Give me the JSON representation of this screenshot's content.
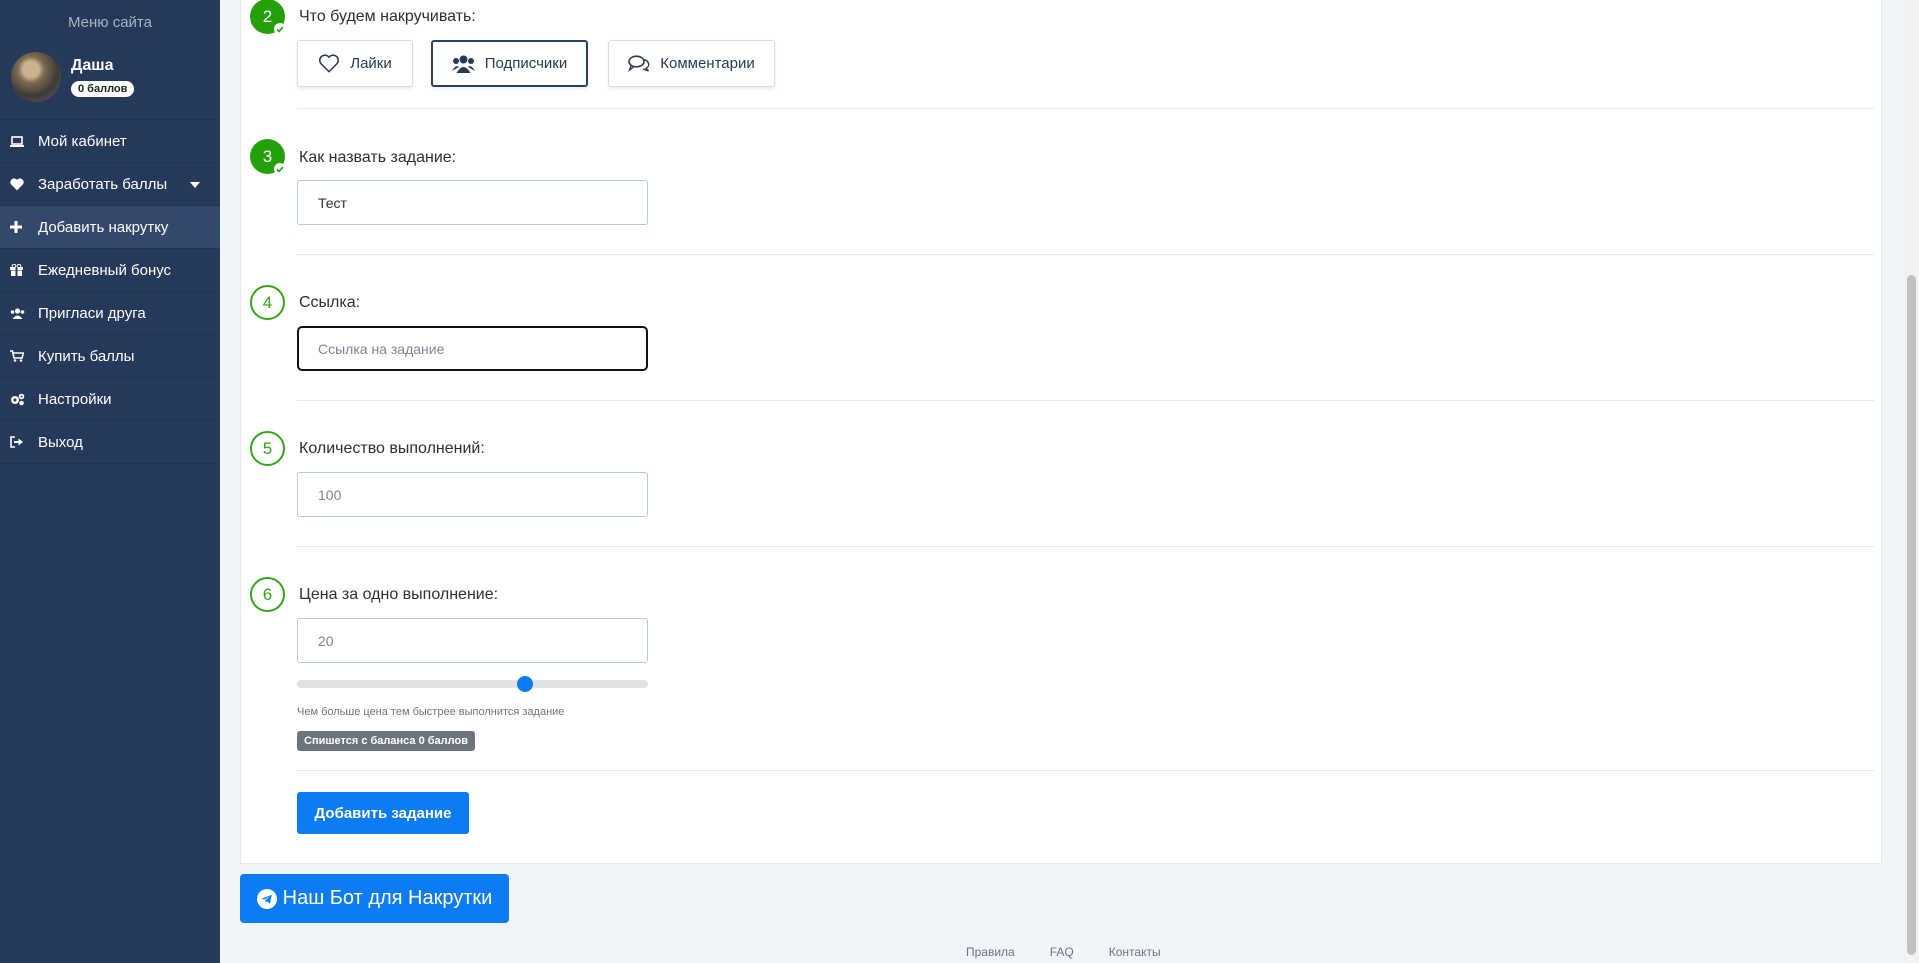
{
  "sidebar": {
    "title": "Меню сайта",
    "user": {
      "name": "Даша",
      "points": "0 баллов"
    },
    "items": [
      {
        "label": "Мой кабинет",
        "icon": "laptop-icon"
      },
      {
        "label": "Заработать баллы",
        "icon": "heart-icon"
      },
      {
        "label": "Добавить накрутку",
        "icon": "plus-icon"
      },
      {
        "label": "Ежедневный бонус",
        "icon": "gift-icon"
      },
      {
        "label": "Пригласи друга",
        "icon": "users-icon"
      },
      {
        "label": "Купить баллы",
        "icon": "cart-icon"
      },
      {
        "label": "Настройки",
        "icon": "gears-icon"
      },
      {
        "label": "Выход",
        "icon": "sign-out-icon"
      }
    ]
  },
  "form": {
    "step2": {
      "number": "2",
      "label": "Что будем накручивать:"
    },
    "types": [
      {
        "label": "Лайки",
        "icon": "heart-outline-icon"
      },
      {
        "label": "Подписчики",
        "icon": "users-icon"
      },
      {
        "label": "Комментарии",
        "icon": "comments-icon"
      }
    ],
    "step3": {
      "number": "3",
      "label": "Как назвать задание:",
      "value": "Тест"
    },
    "step4": {
      "number": "4",
      "label": "Ссылка:",
      "value": "",
      "placeholder": "Ссылка на задание"
    },
    "step5": {
      "number": "5",
      "label": "Количество выполнений:",
      "value": "",
      "placeholder": "100"
    },
    "step6": {
      "number": "6",
      "label": "Цена за одно выполнение:",
      "value": "",
      "placeholder": "20"
    },
    "price_slider_fraction": 0.65,
    "hint": "Чем больше цена тем быстрее выполнится задание",
    "cost_badge": "Спишется с баланса 0 баллов",
    "submit": "Добавить задание"
  },
  "bot_button": {
    "label": "Наш Бот для Накрутки",
    "icon": "telegram-icon"
  },
  "footer": {
    "links": [
      "Правила",
      "FAQ",
      "Контакты"
    ]
  },
  "colors": {
    "sidebar": "#27395a",
    "accent": "#0d7cf2",
    "step_green": "#23a00a"
  }
}
